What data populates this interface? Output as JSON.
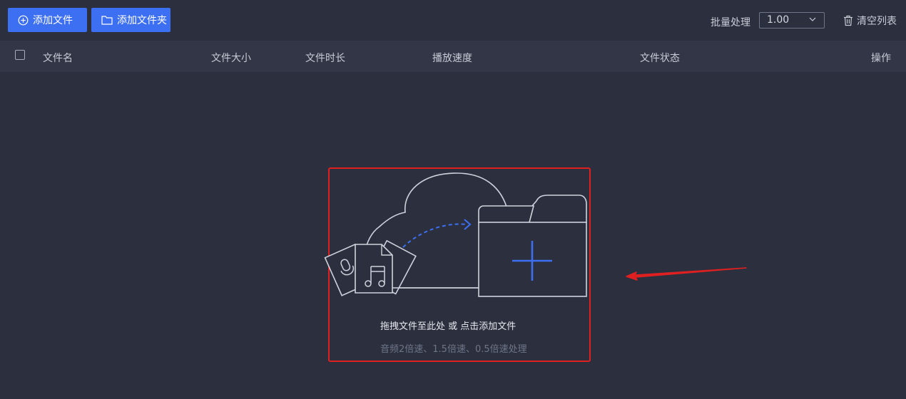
{
  "toolbar": {
    "add_file_label": "添加文件",
    "add_folder_label": "添加文件夹",
    "batch_label": "批量处理",
    "speed_value": "1.00",
    "clear_label": "清空列表"
  },
  "table": {
    "headers": [
      "文件名",
      "文件大小",
      "文件时长",
      "播放速度",
      "文件状态",
      "操作"
    ]
  },
  "drop_zone": {
    "main_text": "拖拽文件至此处 或 点击添加文件",
    "sub_text": "音频2倍速、1.5倍速、0.5倍速处理"
  },
  "colors": {
    "background": "#2c303e",
    "header": "#323646",
    "accent": "#3d6ff2",
    "highlight": "#e02020"
  }
}
